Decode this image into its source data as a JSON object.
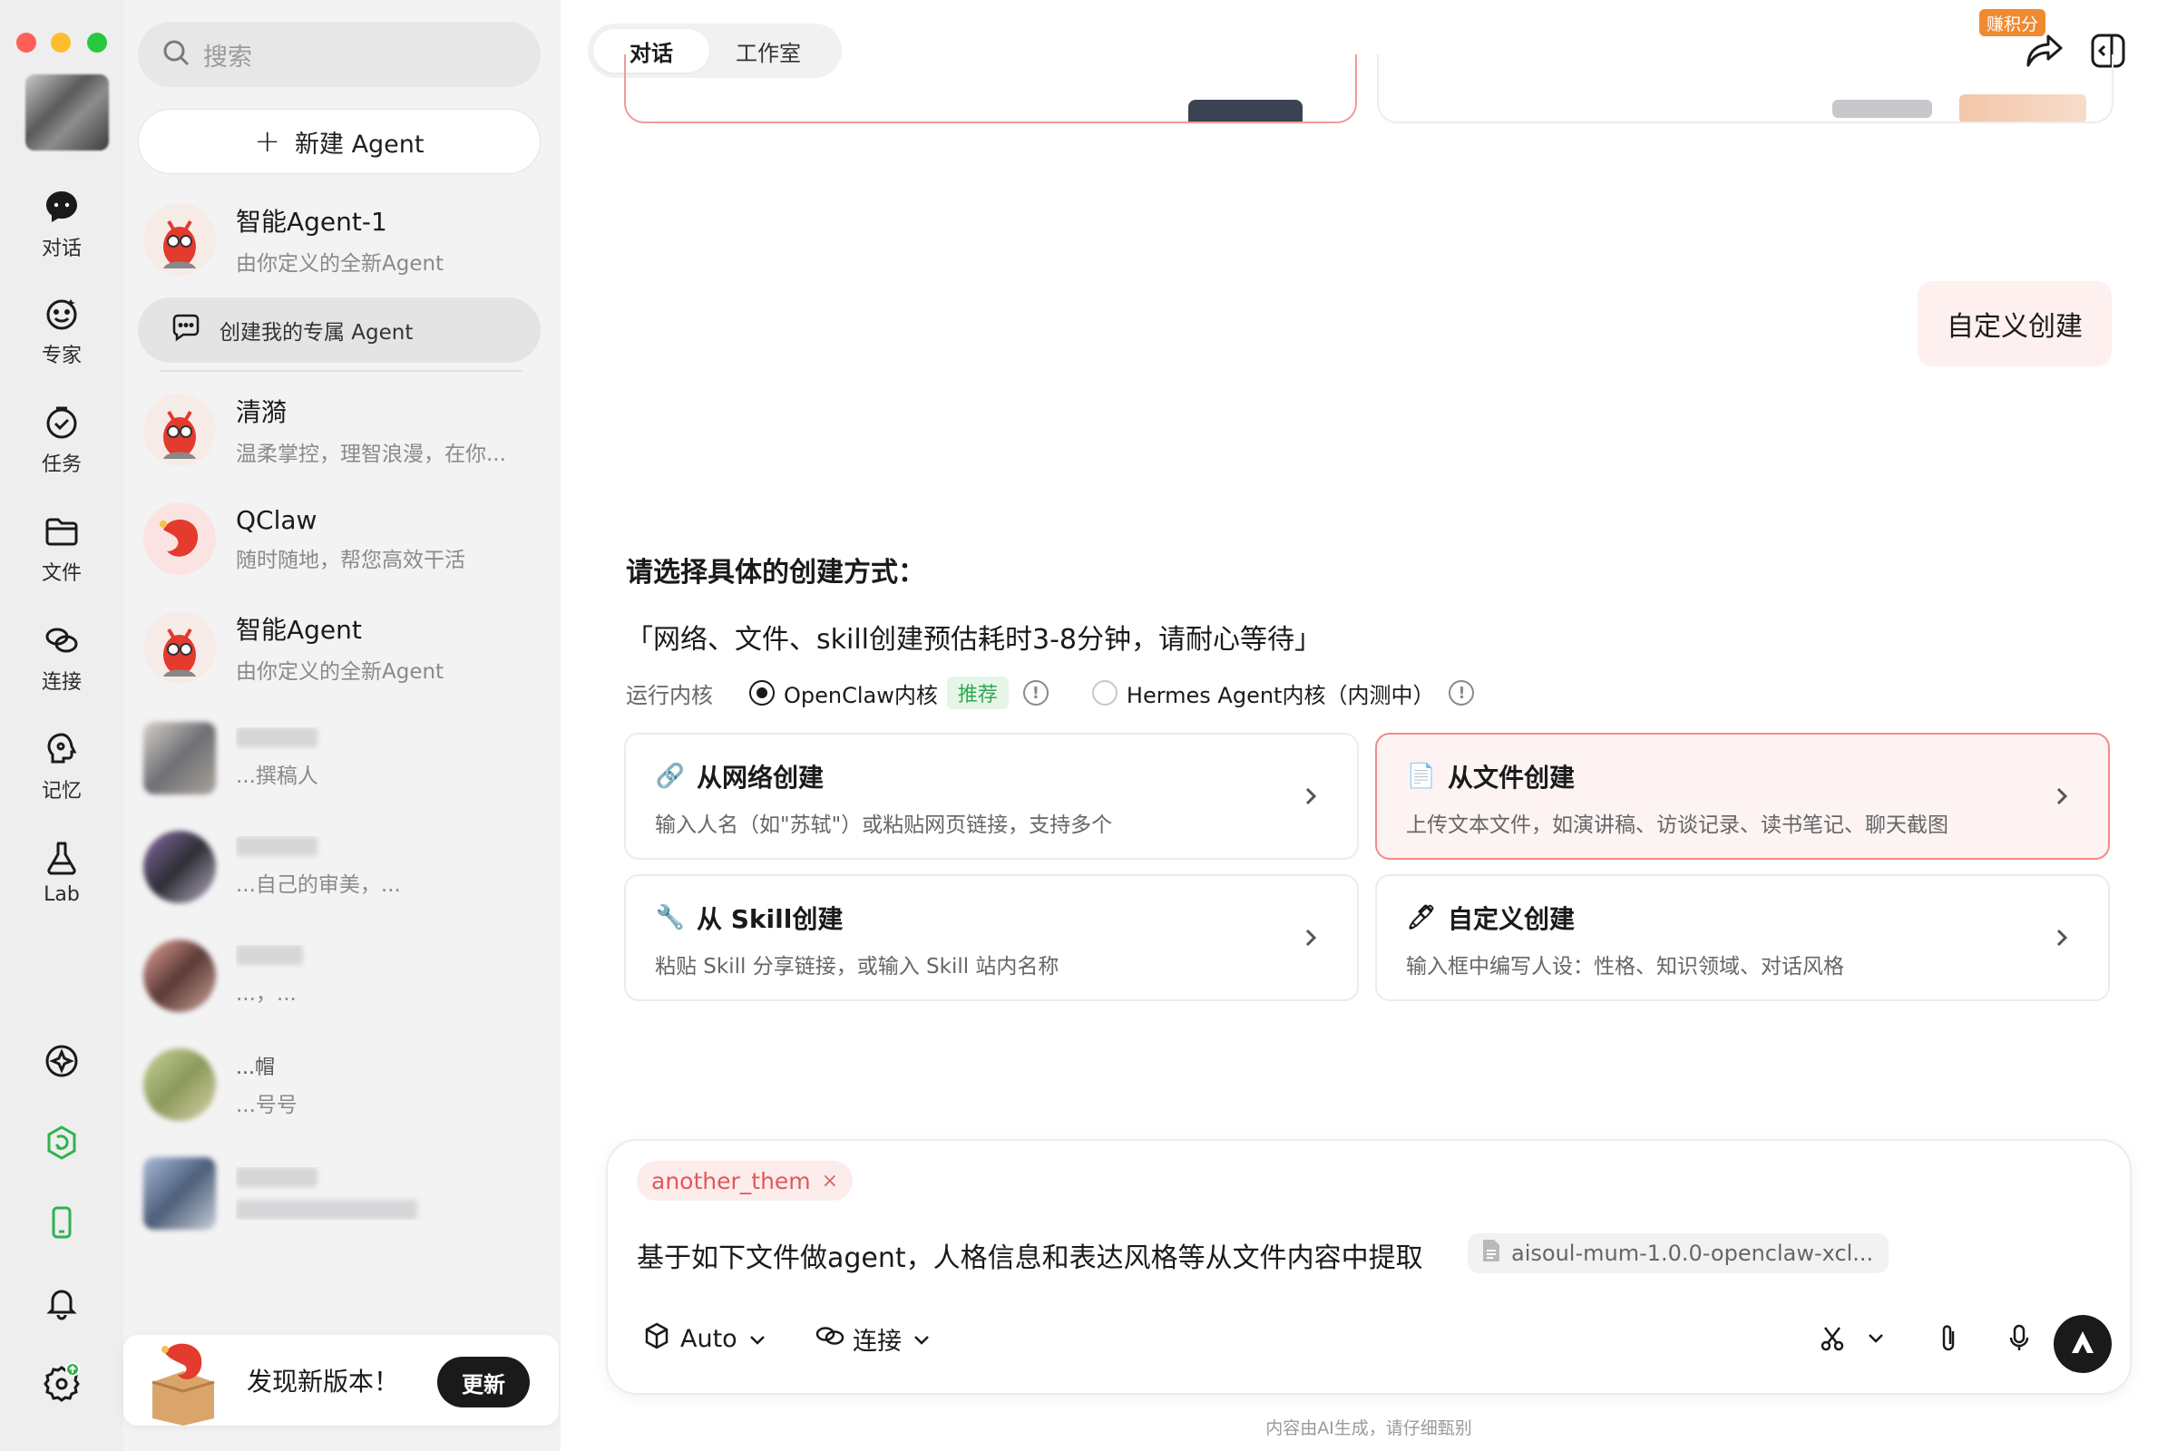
{
  "rail": {
    "items": [
      {
        "label": "对话",
        "icon": "chat-bubble-icon"
      },
      {
        "label": "专家",
        "icon": "smile-face-icon"
      },
      {
        "label": "任务",
        "icon": "task-check-icon"
      },
      {
        "label": "文件",
        "icon": "folder-icon"
      },
      {
        "label": "连接",
        "icon": "link-icon"
      },
      {
        "label": "记忆",
        "icon": "brain-bulb-icon"
      },
      {
        "label": "Lab",
        "icon": "flask-icon"
      }
    ],
    "bottom_icons": [
      "compass-icon",
      "claw-shield-icon",
      "phone-icon",
      "bell-icon",
      "settings-icon"
    ]
  },
  "panel": {
    "search_placeholder": "搜索",
    "new_agent": "新建 Agent",
    "create_mine": "创建我的专属 Agent",
    "agents": [
      {
        "name": "智能Agent-1",
        "desc": "由你定义的全新Agent"
      },
      {
        "name": "清漪",
        "desc": "温柔掌控，理智浪漫，在你..."
      },
      {
        "name": "QClaw",
        "desc": "随时随地，帮您高效干活"
      },
      {
        "name": "智能Agent",
        "desc": "由你定义的全新Agent"
      }
    ],
    "blurred_agents": [
      {
        "name": "",
        "desc": "...撰稿人"
      },
      {
        "name": "",
        "desc": "...自己的审美，..."
      },
      {
        "name": "",
        "desc": "...，..."
      },
      {
        "name": "...帽",
        "desc": "...号号"
      },
      {
        "name": "",
        "desc": ""
      }
    ],
    "update": {
      "message": "发现新版本！",
      "button": "更新"
    }
  },
  "header": {
    "tabs": [
      {
        "label": "对话",
        "active": true
      },
      {
        "label": "工作室",
        "active": false
      }
    ],
    "badge": "赚积分"
  },
  "chat": {
    "user_message": "自定义创建",
    "question": "请选择具体的创建方式：",
    "note": "「网络、文件、skill创建预估耗时3-8分钟，请耐心等待」",
    "kernel": {
      "label": "运行内核",
      "options": [
        {
          "label": "OpenClaw内核",
          "tag": "推荐",
          "selected": true
        },
        {
          "label": "Hermes Agent内核（内测中）",
          "tag": "",
          "selected": false
        }
      ]
    },
    "options": [
      {
        "title": "从网络创建",
        "desc": "输入人名（如\"苏轼\"）或粘贴网页链接，支持多个",
        "icon": "link-emoji-icon",
        "selected": false
      },
      {
        "title": "从文件创建",
        "desc": "上传文本文件，如演讲稿、访谈记录、读书笔记、聊天截图",
        "icon": "document-icon",
        "selected": true
      },
      {
        "title": "从 Skill创建",
        "desc": "粘贴 Skill 分享链接，或输入 Skill 站内名称",
        "icon": "wrench-icon",
        "selected": false
      },
      {
        "title": "自定义创建",
        "desc": "输入框中编写人设：性格、知识领域、对话风格",
        "icon": "pen-icon",
        "selected": false
      }
    ]
  },
  "composer": {
    "chip": "another_them",
    "text": "基于如下文件做agent，人格信息和表达风格等从文件内容中提取",
    "file": "aisoul-mum-1.0.0-openclaw-xcl...",
    "model": "Auto",
    "connect": "连接"
  },
  "footer": "内容由AI生成，请仔细甄别",
  "colors": {
    "accent_red": "#f28b8b",
    "chip_text": "#e05858",
    "recommend_green": "#2fa84f",
    "badge_orange": "#f08a30"
  }
}
